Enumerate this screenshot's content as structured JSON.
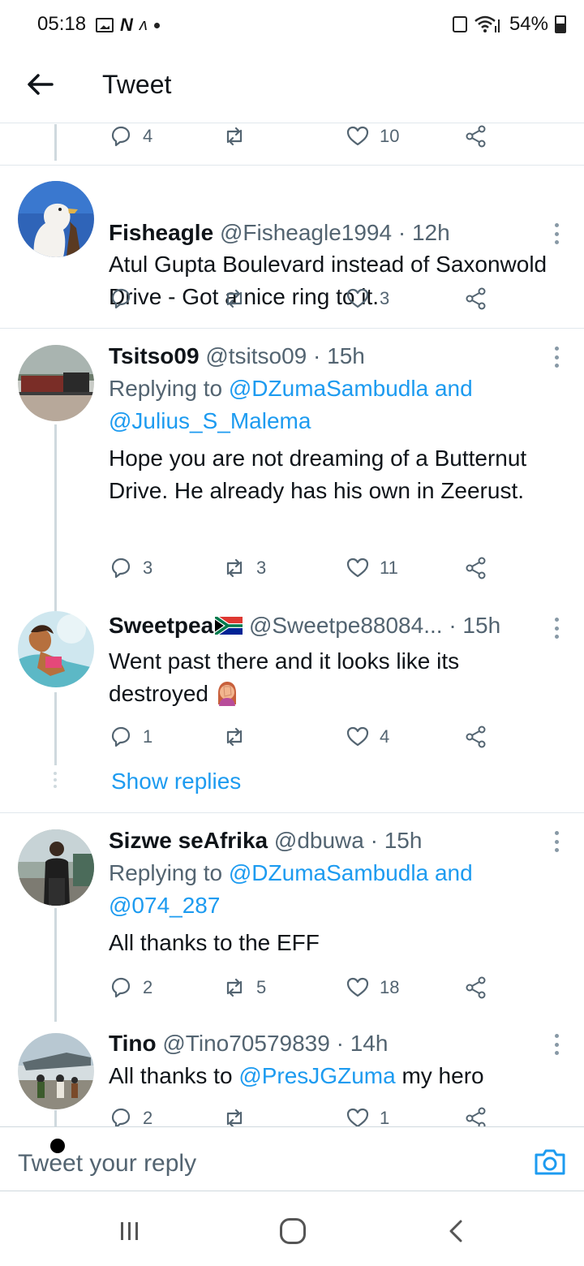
{
  "status_bar": {
    "time": "05:18",
    "battery": "54%"
  },
  "header": {
    "title": "Tweet"
  },
  "top_actions": {
    "reply_count": "4",
    "retweet_count": "",
    "like_count": "10"
  },
  "tweets": [
    {
      "name": "Fisheagle",
      "handle": "@Fisheagle1994 · 12h",
      "text": "Atul Gupta Boulevard instead of Saxonwold Drive - Got a nice ring to it.",
      "reply_count": "",
      "retweet_count": "",
      "like_count": "3"
    },
    {
      "name": "Tsitso09",
      "handle": "@tsitso09 · 15h",
      "replying_prefix": "Replying to ",
      "replying_to": "@DZumaSambudla and",
      "replying_to_2": "@Julius_S_Malema",
      "text": "Hope you are not dreaming of a Butternut Drive. He already has his own in Zeerust.",
      "reply_count": "3",
      "retweet_count": "3",
      "like_count": "11"
    },
    {
      "name": "Sweetpea",
      "handle": "@Sweetpe88084... · 15h",
      "text": "Went past there and it looks like its destroyed",
      "reply_count": "1",
      "retweet_count": "",
      "like_count": "4",
      "show_replies": "Show replies"
    },
    {
      "name": "Sizwe seAfrika",
      "handle": "@dbuwa · 15h",
      "replying_prefix": "Replying to ",
      "replying_to": "@DZumaSambudla and",
      "replying_to_2": "@074_287",
      "text": "All thanks to the EFF",
      "reply_count": "2",
      "retweet_count": "5",
      "like_count": "18"
    },
    {
      "name": "Tino",
      "handle": "@Tino70579839 · 14h",
      "text_prefix": "All thanks to ",
      "mention": "@PresJGZuma",
      "text_suffix": " my hero",
      "reply_count": "2",
      "retweet_count": "",
      "like_count": "1"
    }
  ],
  "reply_bar": {
    "placeholder": "Tweet your reply"
  },
  "colors": {
    "link": "#1d9bf0",
    "muted": "#536471",
    "divider": "#e1e8ed"
  }
}
